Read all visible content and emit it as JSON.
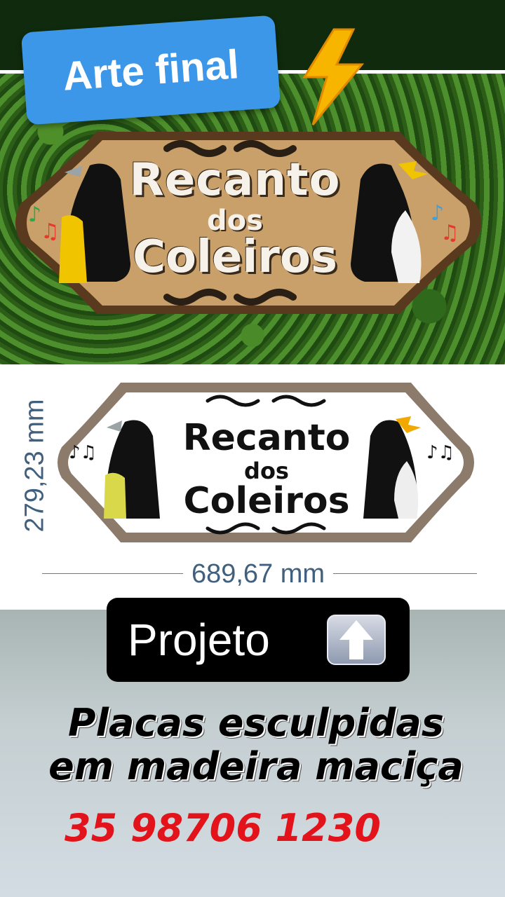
{
  "badge": {
    "text": "Arte final"
  },
  "icons": {
    "bolt": "lightning-icon",
    "up": "up-arrow-icon"
  },
  "wood_sign": {
    "line1": "Recanto",
    "line2": "dos",
    "line3": "Coleiros"
  },
  "drawing": {
    "line1": "Recanto",
    "line2": "dos",
    "line3": "Coleiros",
    "height_label": "279,23 mm",
    "width_label": "689,67 mm"
  },
  "projeto_button": {
    "label": "Projeto"
  },
  "headline": {
    "line1": "Placas esculpidas",
    "line2": "em madeira maciça"
  },
  "phone": "35 98706 1230",
  "colors": {
    "badge_blue": "#3d97e8",
    "phone_red": "#e3131b",
    "wood": "#c89a62",
    "dim_text": "#41607e"
  }
}
